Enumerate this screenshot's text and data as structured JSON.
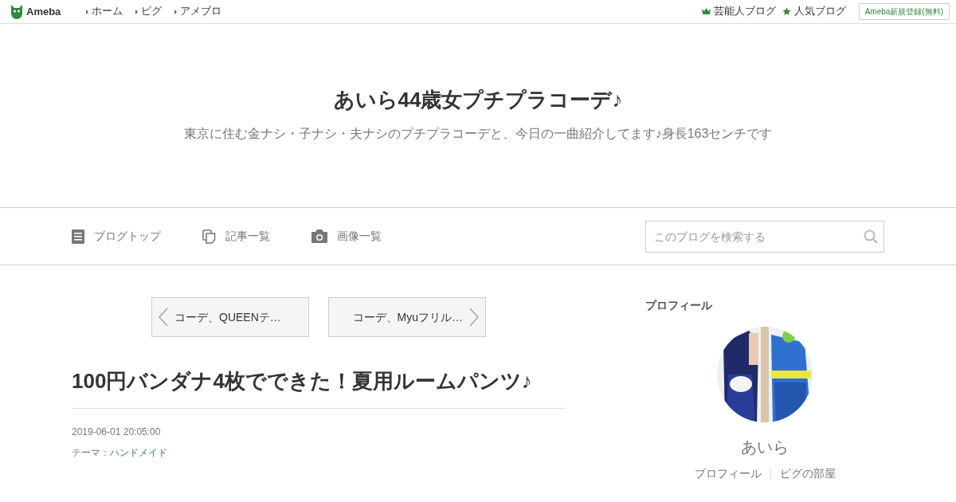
{
  "topbar": {
    "logo": "Ameba",
    "links": [
      {
        "label": "ホーム"
      },
      {
        "label": "ピグ"
      },
      {
        "label": "アメブロ"
      }
    ],
    "right_links": [
      {
        "label": "芸能人ブログ",
        "kind": "crown"
      },
      {
        "label": "人気ブログ",
        "kind": "star"
      }
    ],
    "register_button": "Ameba新規登録(無料)"
  },
  "blog": {
    "title": "あいら44歳女プチプラコーデ♪",
    "description": "東京に住む金ナシ・子ナシ・夫ナシのプチプラコーデと、今日の一曲紹介してます♪身長163センチです"
  },
  "nav": {
    "items": [
      {
        "label": "ブログトップ",
        "kind": "doc"
      },
      {
        "label": "記事一覧",
        "kind": "copy"
      },
      {
        "label": "画像一覧",
        "kind": "camera"
      }
    ],
    "search": {
      "placeholder": "このブログを検索する"
    }
  },
  "pager": [
    {
      "label": "コーデ、QUEENテ…",
      "kind": "prev"
    },
    {
      "label": "コーデ、Myuフリル…",
      "kind": "next"
    }
  ],
  "article": {
    "title": "100円バンダナ4枚でできた！夏用ルームパンツ♪",
    "date": "2019-06-01 20:05:00",
    "theme_label": "テーマ：",
    "theme": "ハンドメイド"
  },
  "profile": {
    "heading": "プロフィール",
    "name": "あいら",
    "links": [
      {
        "label": "プロフィール"
      },
      {
        "label": "ピグの部屋"
      }
    ]
  }
}
